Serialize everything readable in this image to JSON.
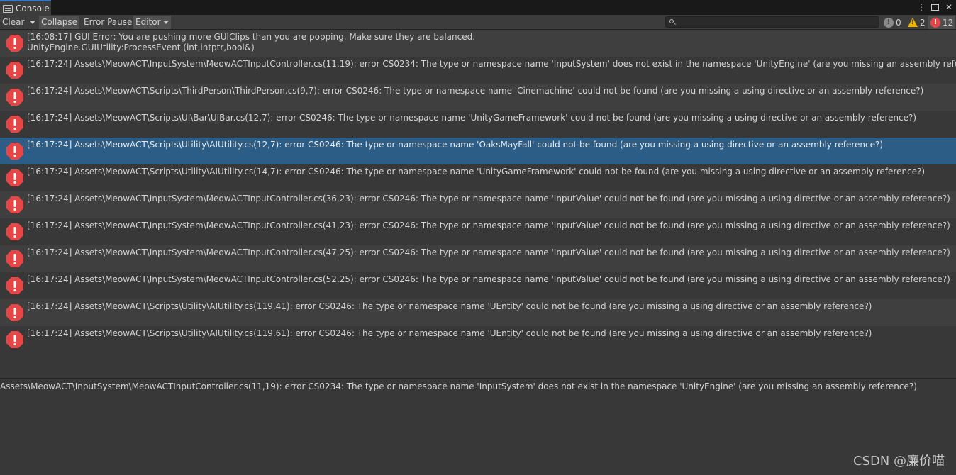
{
  "window": {
    "tab_label": "Console",
    "tab_icon": "console-icon",
    "controls": [
      "more-options-icon",
      "maximize-icon",
      "close-icon"
    ]
  },
  "toolbar": {
    "clear_label": "Clear",
    "collapse_label": "Collapse",
    "error_pause_label": "Error Pause",
    "editor_label": "Editor",
    "search_placeholder": "",
    "search_value": "",
    "counts": {
      "info": "0",
      "warnings": "2",
      "errors": "12"
    }
  },
  "logs": [
    {
      "line1": "[16:08:17] GUI Error: You are pushing more GUIClips than you are popping. Make sure they are balanced.",
      "line2": "UnityEngine.GUIUtility:ProcessEvent (int,intptr,bool&)"
    },
    {
      "line1": "[16:17:24] Assets\\MeowACT\\InputSystem\\MeowACTInputController.cs(11,19): error CS0234: The type or namespace name 'InputSystem' does not exist in the namespace 'UnityEngine' (are you missing an assembly reference?)",
      "line2": ""
    },
    {
      "line1": "[16:17:24] Assets\\MeowACT\\Scripts\\ThirdPerson\\ThirdPerson.cs(9,7): error CS0246: The type or namespace name 'Cinemachine' could not be found (are you missing a using directive or an assembly reference?)",
      "line2": ""
    },
    {
      "line1": "[16:17:24] Assets\\MeowACT\\Scripts\\UI\\Bar\\UIBar.cs(12,7): error CS0246: The type or namespace name 'UnityGameFramework' could not be found (are you missing a using directive or an assembly reference?)",
      "line2": ""
    },
    {
      "line1": "[16:17:24] Assets\\MeowACT\\Scripts\\Utility\\AIUtility.cs(12,7): error CS0246: The type or namespace name 'OaksMayFall' could not be found (are you missing a using directive or an assembly reference?)",
      "line2": ""
    },
    {
      "line1": "[16:17:24] Assets\\MeowACT\\Scripts\\Utility\\AIUtility.cs(14,7): error CS0246: The type or namespace name 'UnityGameFramework' could not be found (are you missing a using directive or an assembly reference?)",
      "line2": ""
    },
    {
      "line1": "[16:17:24] Assets\\MeowACT\\InputSystem\\MeowACTInputController.cs(36,23): error CS0246: The type or namespace name 'InputValue' could not be found (are you missing a using directive or an assembly reference?)",
      "line2": ""
    },
    {
      "line1": "[16:17:24] Assets\\MeowACT\\InputSystem\\MeowACTInputController.cs(41,23): error CS0246: The type or namespace name 'InputValue' could not be found (are you missing a using directive or an assembly reference?)",
      "line2": ""
    },
    {
      "line1": "[16:17:24] Assets\\MeowACT\\InputSystem\\MeowACTInputController.cs(47,25): error CS0246: The type or namespace name 'InputValue' could not be found (are you missing a using directive or an assembly reference?)",
      "line2": ""
    },
    {
      "line1": "[16:17:24] Assets\\MeowACT\\InputSystem\\MeowACTInputController.cs(52,25): error CS0246: The type or namespace name 'InputValue' could not be found (are you missing a using directive or an assembly reference?)",
      "line2": ""
    },
    {
      "line1": "[16:17:24] Assets\\MeowACT\\Scripts\\Utility\\AIUtility.cs(119,41): error CS0246: The type or namespace name 'UEntity' could not be found (are you missing a using directive or an assembly reference?)",
      "line2": ""
    },
    {
      "line1": "[16:17:24] Assets\\MeowACT\\Scripts\\Utility\\AIUtility.cs(119,61): error CS0246: The type or namespace name 'UEntity' could not be found (are you missing a using directive or an assembly reference?)",
      "line2": ""
    }
  ],
  "selected_index": 4,
  "detail": {
    "text": "Assets\\MeowACT\\InputSystem\\MeowACTInputController.cs(11,19): error CS0234: The type or namespace name 'InputSystem' does not exist in the namespace 'UnityEngine' (are you missing an assembly reference?)"
  },
  "watermark": "CSDN @廉价喵",
  "colors": {
    "error_red": "#e64646",
    "selected_row": "#2c5d87",
    "warning_yellow": "#f0b400",
    "tab_accent": "#3a79bb"
  }
}
